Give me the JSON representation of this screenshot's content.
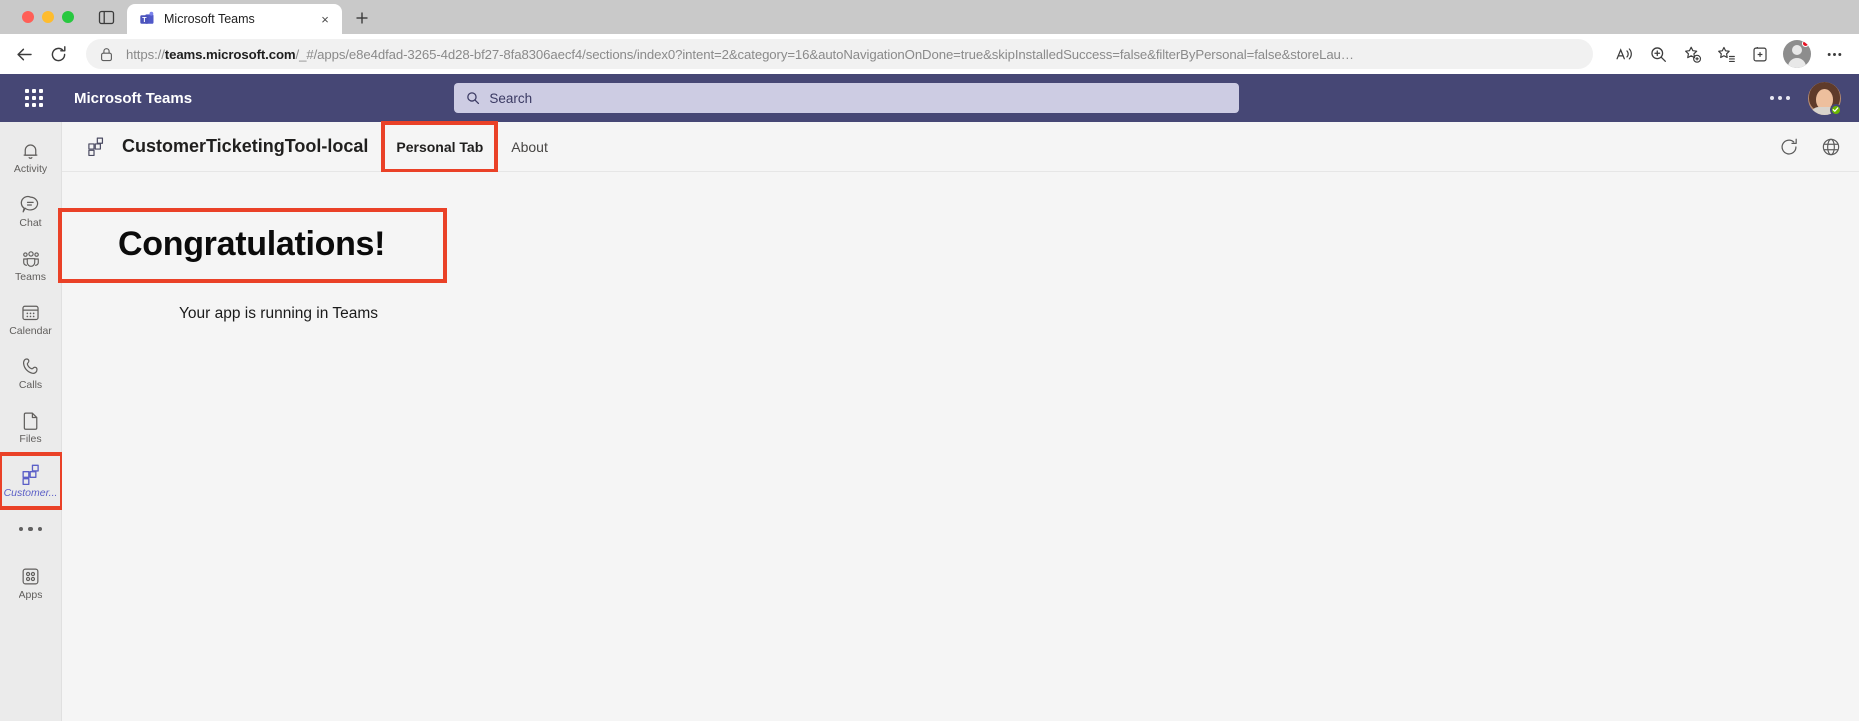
{
  "browser": {
    "tab": {
      "title": "Microsoft Teams",
      "favicon_name": "teams-favicon",
      "close_label": "×",
      "new_tab_label": "+"
    },
    "toolbar": {
      "back_label": "←",
      "reload_label": "↻",
      "url_prefix": "https://",
      "url_domain": "teams.microsoft.com",
      "url_rest": "/_#/apps/e8e4dfad-3265-4d28-bf27-8fa8306aecf4/sections/index0?intent=2&category=16&autoNavigationOnDone=true&skipInstalledSuccess=false&filterByPersonal=false&storeLau…",
      "icons": [
        "read-aloud-icon",
        "zoom-icon",
        "add-favorite-icon",
        "favorites-icon",
        "collections-icon",
        "browser-profile-icon",
        "browser-settings-icon"
      ]
    }
  },
  "teams": {
    "titlebar": {
      "waffle_name": "app-launcher-icon",
      "brand": "Microsoft Teams",
      "search_placeholder": "Search",
      "more_label": "…",
      "avatar_name": "user-avatar",
      "presence": "available"
    },
    "rail": {
      "items": [
        {
          "label": "Activity",
          "icon": "bell-icon",
          "active": false,
          "highlight": false
        },
        {
          "label": "Chat",
          "icon": "chat-icon",
          "active": false,
          "highlight": false
        },
        {
          "label": "Teams",
          "icon": "teams-icon",
          "active": false,
          "highlight": false
        },
        {
          "label": "Calendar",
          "icon": "calendar-icon",
          "active": false,
          "highlight": false
        },
        {
          "label": "Calls",
          "icon": "phone-icon",
          "active": false,
          "highlight": false
        },
        {
          "label": "Files",
          "icon": "file-icon",
          "active": false,
          "highlight": false
        },
        {
          "label": "Customer...",
          "icon": "app-blocks-icon",
          "active": true,
          "highlight": true
        }
      ],
      "more_label": "…",
      "apps": {
        "label": "Apps",
        "icon": "apps-grid-icon"
      }
    },
    "app_header": {
      "app_icon": "app-blocks-icon",
      "title": "CustomerTicketingTool-local",
      "tabs": [
        {
          "label": "Personal Tab",
          "selected": true,
          "highlight": true
        },
        {
          "label": "About",
          "selected": false,
          "highlight": false
        }
      ],
      "right_icons": [
        "refresh-icon",
        "globe-icon"
      ]
    },
    "content": {
      "heading": "Congratulations!",
      "subtext": "Your app is running in Teams"
    }
  },
  "annotation": {
    "highlight_color": "#ea4127"
  }
}
